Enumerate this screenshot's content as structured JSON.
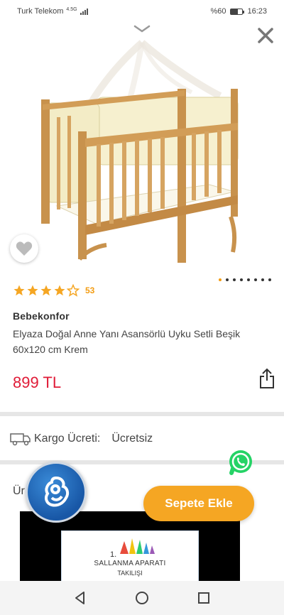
{
  "status_bar": {
    "carrier": "Turk Telekom",
    "network": "4.5G",
    "battery_percent": "%60",
    "time": "16:23",
    "battery_level": 0.6
  },
  "product": {
    "rating_stars": 4,
    "rating_count": "53",
    "brand": "Bebekonfor",
    "title": "Elyaza Doğal Anne Yanı Asansörlü Uyku Setli Beşik 60x120 cm Krem",
    "price": "899 TL",
    "image_count": 8,
    "active_image": 0
  },
  "shipping": {
    "label": "Kargo Ücreti:",
    "value": "Ücretsiz"
  },
  "section": {
    "title": "Ür          ması"
  },
  "video": {
    "text_line1": "SALLANMA APARATI",
    "text_line2": "TAKILIŞI",
    "number": "1."
  },
  "actions": {
    "add_to_cart": "Sepete Ekle"
  },
  "colors": {
    "accent": "#f5a623",
    "price": "#e01b37",
    "star": "#f5a623",
    "whatsapp": "#25d366"
  },
  "icons": {
    "close": "close-icon",
    "chevron": "chevron-down-icon",
    "favorite": "heart-icon",
    "share": "share-icon",
    "truck": "truck-icon",
    "whatsapp": "whatsapp-icon",
    "assistant": "assistant-icon"
  }
}
